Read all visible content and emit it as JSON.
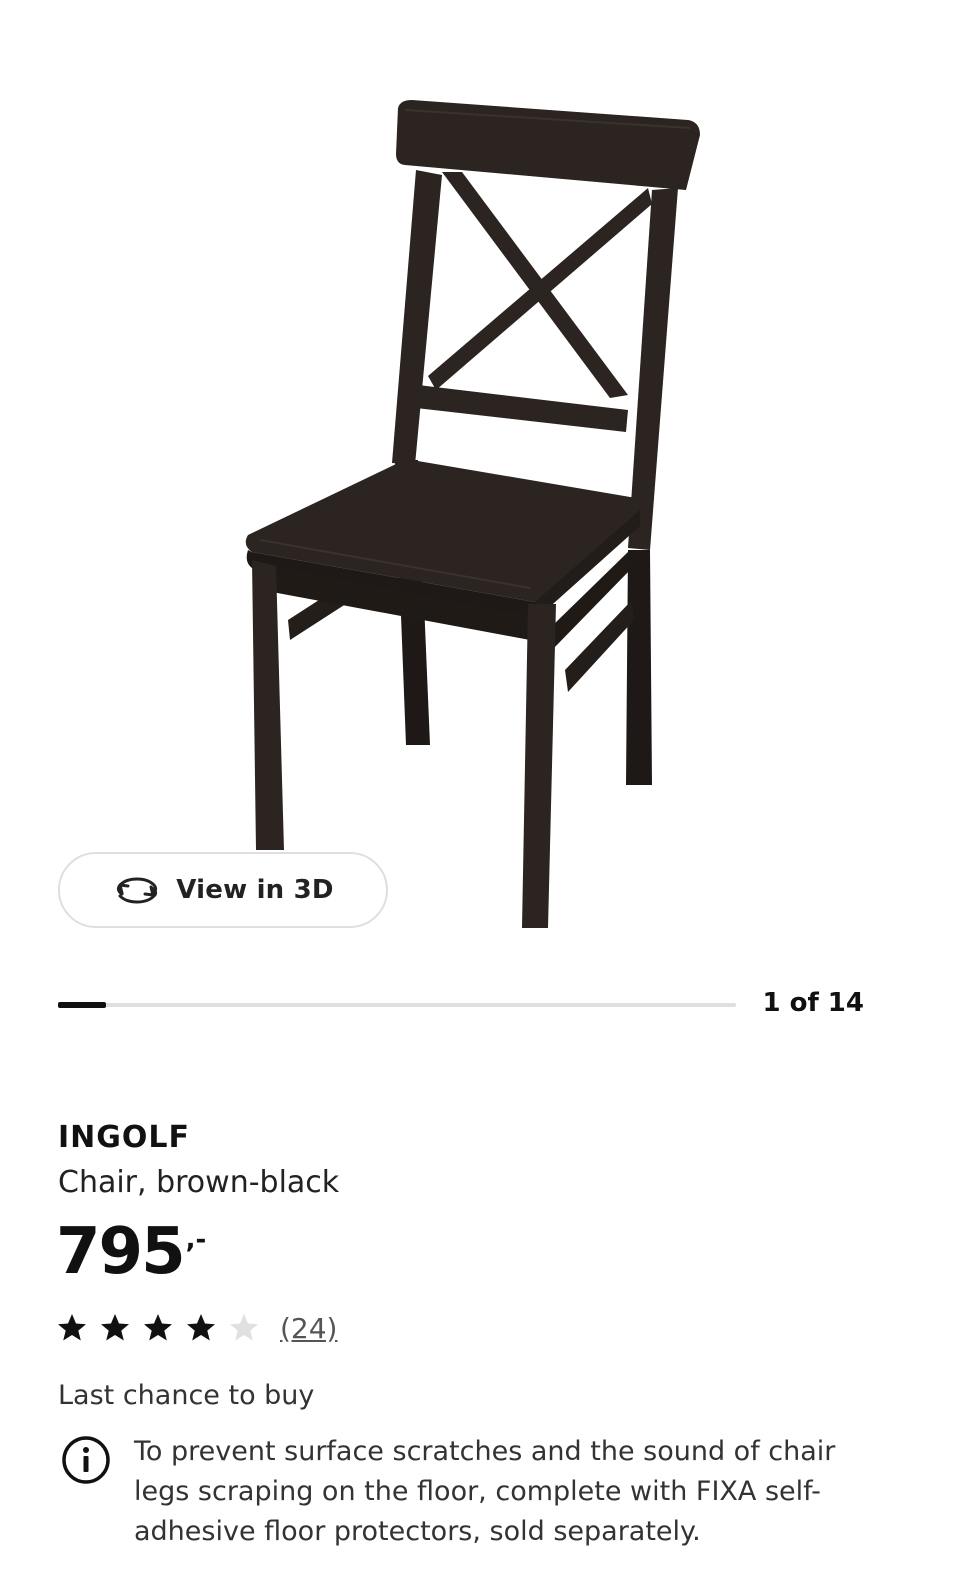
{
  "gallery": {
    "view3d_label": "View in 3D",
    "view3d_icon": "rotate-3d-icon",
    "counter": "1 of 14",
    "current_image": 1,
    "total_images": 14,
    "progress_fraction": 0.0714
  },
  "product": {
    "name": "INGOLF",
    "description": "Chair, brown-black",
    "price": {
      "amount": "795",
      "suffix": ",-"
    },
    "rating": {
      "value": 4,
      "max": 5,
      "review_count_label": "(24)",
      "filled_color": "#111111",
      "empty_color": "#e0e0e0"
    },
    "availability": "Last chance to buy",
    "notice": {
      "icon": "info-icon",
      "text": "To prevent surface scratches and the sound of chair legs scraping on the floor, complete with FIXA self-adhesive floor protectors, sold separately."
    }
  },
  "colors": {
    "chair": "#2b2420",
    "chair_shade": "#1e1916",
    "text_primary": "#111111",
    "border": "#dfdfdf"
  }
}
